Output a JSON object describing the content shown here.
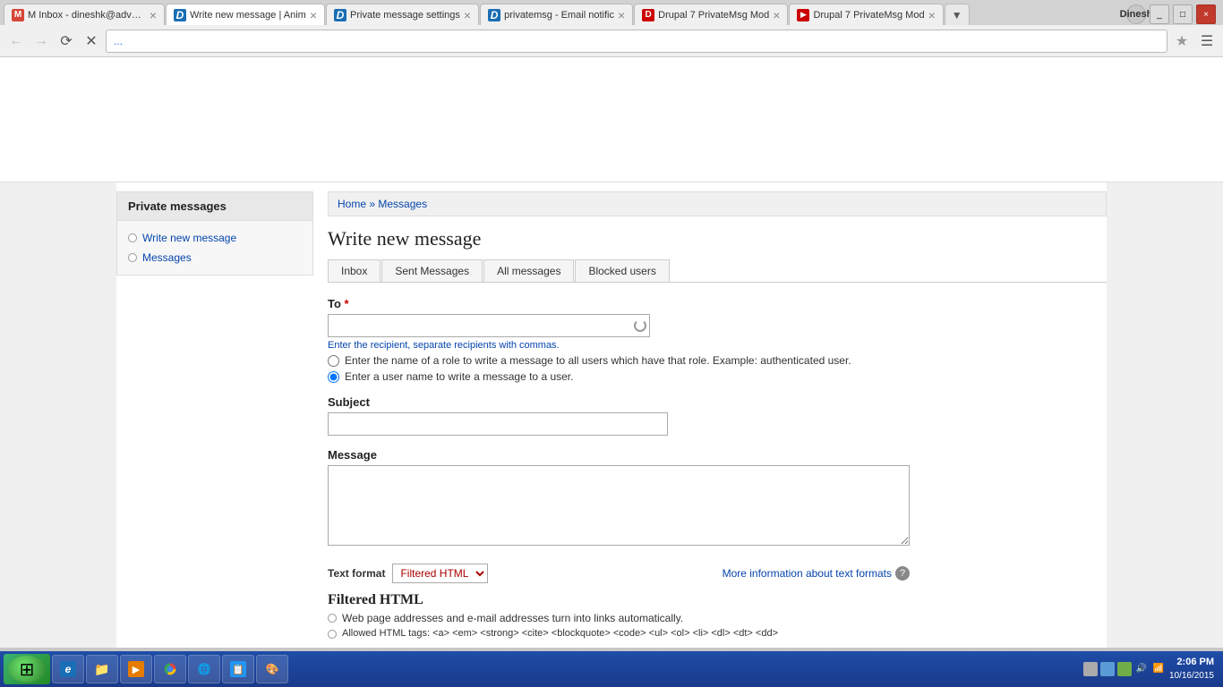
{
  "browser": {
    "tabs": [
      {
        "id": "tab1",
        "title": "M Inbox - dineshk@advents",
        "favicon_text": "M",
        "favicon_color": "#d44638",
        "active": false
      },
      {
        "id": "tab2",
        "title": "Write new message | Anim",
        "favicon_text": "W",
        "favicon_color": "#4285f4",
        "active": true
      },
      {
        "id": "tab3",
        "title": "Private message settings",
        "favicon_text": "P",
        "favicon_color": "#4285f4",
        "active": false
      },
      {
        "id": "tab4",
        "title": "privatemsg - Email notific",
        "favicon_text": "P",
        "favicon_color": "#4285f4",
        "active": false
      },
      {
        "id": "tab5",
        "title": "Drupal 7 PrivateMsg Mod",
        "favicon_text": "D",
        "favicon_color": "#c00",
        "active": false
      },
      {
        "id": "tab6",
        "title": "Drupal 7 PrivateMsg Mod",
        "favicon_text": "▶",
        "favicon_color": "#c00",
        "active": false
      }
    ],
    "address": "...",
    "user_label": "Dinesh"
  },
  "sidebar": {
    "title": "Private messages",
    "nav_items": [
      {
        "id": "write-new",
        "label": "Write new message"
      },
      {
        "id": "messages",
        "label": "Messages"
      }
    ]
  },
  "breadcrumb": {
    "home": "Home",
    "separator": "»",
    "current": "Messages"
  },
  "page": {
    "title": "Write new message",
    "tabs": [
      {
        "id": "inbox",
        "label": "Inbox"
      },
      {
        "id": "sent",
        "label": "Sent Messages"
      },
      {
        "id": "all",
        "label": "All messages"
      },
      {
        "id": "blocked",
        "label": "Blocked users"
      }
    ]
  },
  "form": {
    "to_label": "To",
    "to_placeholder": "",
    "to_help": "Enter the recipient, separate recipients with commas.",
    "radio1_label": "Enter the name of a role to write a message to all users which have that role. Example: authenticated user.",
    "radio2_label": "Enter a user name to write a message to a user.",
    "subject_label": "Subject",
    "message_label": "Message"
  },
  "text_format": {
    "label": "Text format",
    "value": "Filtered HTML",
    "more_info": "More information about text formats",
    "filtered_title": "Filtered HTML",
    "items": [
      {
        "text": "Web page addresses and e-mail addresses turn into links automatically."
      },
      {
        "text": "Allowed HTML tags: <a> <em> <strong> <cite> <blockquote> <code> <ul> <ol> <li> <dl> <dt> <dd>"
      }
    ]
  },
  "taskbar": {
    "time": "2:06 PM",
    "date": "10/16/2015",
    "apps": [
      {
        "id": "start",
        "label": "⊞"
      },
      {
        "id": "ie",
        "label": "e"
      },
      {
        "id": "folder",
        "label": "📁"
      },
      {
        "id": "media",
        "label": "▶"
      },
      {
        "id": "chrome",
        "label": "⊕"
      },
      {
        "id": "network",
        "label": "🌐"
      },
      {
        "id": "app1",
        "label": "📋"
      },
      {
        "id": "app2",
        "label": "🎨"
      }
    ]
  }
}
